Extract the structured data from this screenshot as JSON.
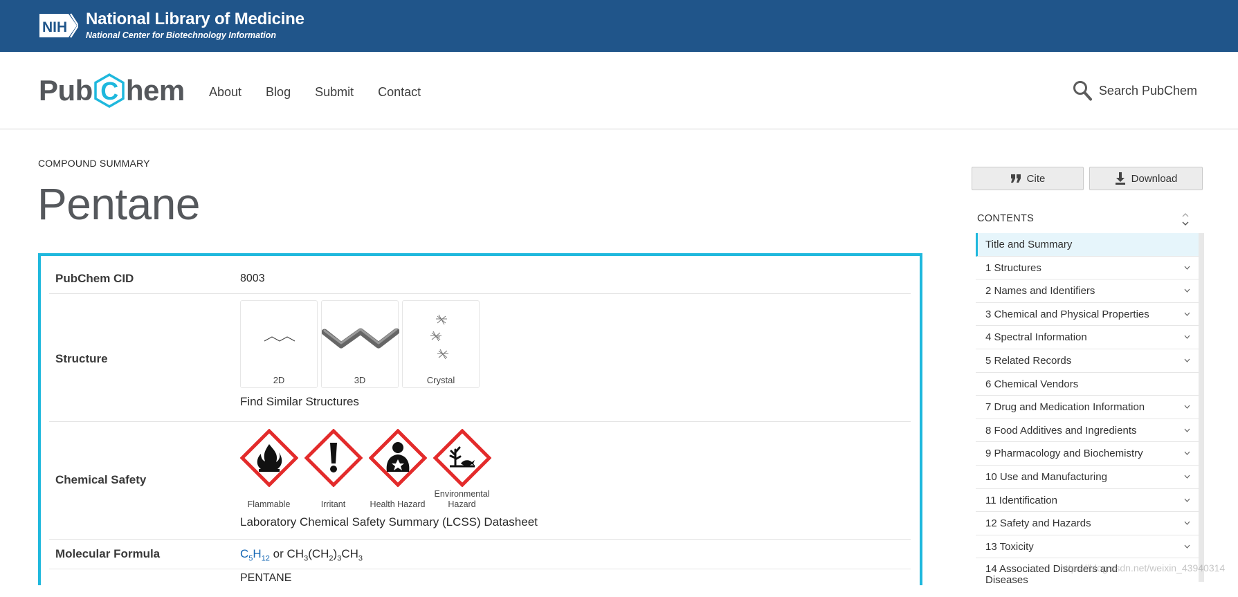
{
  "banner": {
    "logo_text": "NIH",
    "title": "National Library of Medicine",
    "subtitle": "National Center for Biotechnology Information"
  },
  "header": {
    "logo_pre": "Pub",
    "logo_hex": "C",
    "logo_post": "hem",
    "nav": [
      "About",
      "Blog",
      "Submit",
      "Contact"
    ],
    "search_label": "Search PubChem"
  },
  "page": {
    "eyebrow": "COMPOUND SUMMARY",
    "title": "Pentane"
  },
  "summary": {
    "cid_label": "PubChem CID",
    "cid_value": "8003",
    "structure_label": "Structure",
    "structure_cards": [
      "2D",
      "3D",
      "Crystal"
    ],
    "find_similar": "Find Similar Structures",
    "safety_label": "Chemical Safety",
    "hazards": [
      {
        "name": "Flammable",
        "icon": "flame-pictogram"
      },
      {
        "name": "Irritant",
        "icon": "exclamation-pictogram"
      },
      {
        "name": "Health Hazard",
        "icon": "health-hazard-pictogram"
      },
      {
        "name": "Environmental Hazard",
        "icon": "environment-pictogram"
      }
    ],
    "lcss_link": "Laboratory Chemical Safety Summary (LCSS) Datasheet",
    "formula_label": "Molecular Formula",
    "formula": {
      "link_main": "C",
      "link_sub1": "5",
      "link_main2": "H",
      "link_sub2": "12",
      "or": " or ",
      "t1": "CH",
      "s1": "3",
      "t2": "(CH",
      "s2": "2",
      "t3": ")",
      "s3": "3",
      "t4": "CH",
      "s4": "3"
    },
    "next_value": "PENTANE"
  },
  "sidebar": {
    "cite_label": "Cite",
    "download_label": "Download",
    "contents_heading": "CONTENTS",
    "toc": [
      {
        "label": "Title and Summary",
        "expandable": false,
        "active": true
      },
      {
        "label": "1 Structures",
        "expandable": true
      },
      {
        "label": "2 Names and Identifiers",
        "expandable": true
      },
      {
        "label": "3 Chemical and Physical Properties",
        "expandable": true
      },
      {
        "label": "4 Spectral Information",
        "expandable": true
      },
      {
        "label": "5 Related Records",
        "expandable": true
      },
      {
        "label": "6 Chemical Vendors",
        "expandable": false
      },
      {
        "label": "7 Drug and Medication Information",
        "expandable": true
      },
      {
        "label": "8 Food Additives and Ingredients",
        "expandable": true
      },
      {
        "label": "9 Pharmacology and Biochemistry",
        "expandable": true
      },
      {
        "label": "10 Use and Manufacturing",
        "expandable": true
      },
      {
        "label": "11 Identification",
        "expandable": true
      },
      {
        "label": "12 Safety and Hazards",
        "expandable": true
      },
      {
        "label": "13 Toxicity",
        "expandable": true
      },
      {
        "label": "14 Associated Disorders and Diseases",
        "expandable": false
      }
    ]
  },
  "watermark": "https://blog.csdn.net/weixin_43940314",
  "colors": {
    "nih_blue": "#20558a",
    "accent_cyan": "#1fb8dd",
    "link_blue": "#1668b5",
    "hazard_red": "#e32b2b"
  }
}
